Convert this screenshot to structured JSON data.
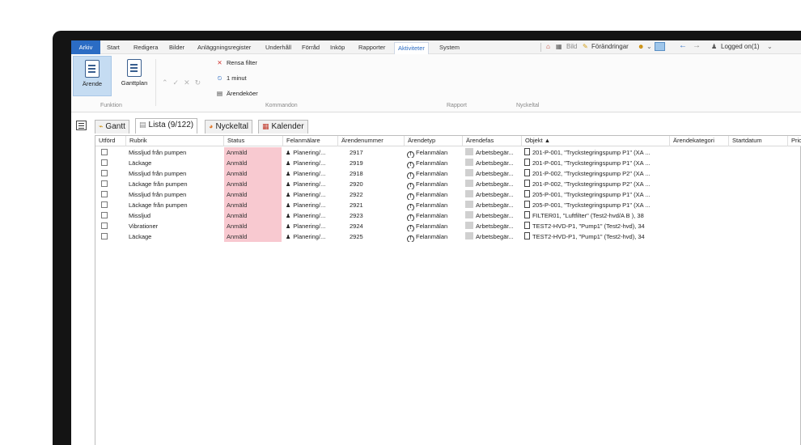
{
  "menu": {
    "items": [
      "Arkiv",
      "Start",
      "Redigera",
      "Bilder",
      "Anläggningsregister",
      "Underhåll",
      "Förråd",
      "Inköp",
      "Rapporter",
      "Aktiviteter",
      "System"
    ],
    "active": "Aktiviteter"
  },
  "quick_access": {
    "bild_label": "Bild",
    "changes_label": "Förändringar",
    "logged_on": "Logged on(1)"
  },
  "ribbon": {
    "arende_label": "Ärende",
    "ganttplan_label": "Ganttplan",
    "rensa_filter": "Rensa filter",
    "minute_label": "1 minut",
    "arendekoer": "Ärendeköer",
    "groups": [
      "Funktion",
      "Kommandon",
      "Rapport",
      "Nyckeltal"
    ]
  },
  "tabs": [
    {
      "label": "Gantt",
      "icon": "gantt-icon"
    },
    {
      "label": "Lista (9/122)",
      "icon": "list-icon"
    },
    {
      "label": "Nyckeltal",
      "icon": "pie-icon"
    },
    {
      "label": "Kalender",
      "icon": "calendar-icon"
    }
  ],
  "grid": {
    "columns": [
      "Utförd",
      "Rubrik",
      "Status",
      "Felanmälare",
      "Ärendenummer",
      "Ärendetyp",
      "Ärendefas",
      "Objekt ▲",
      "Ärendekategori",
      "Startdatum",
      "Prio"
    ],
    "rows": [
      {
        "rubrik": "Missljud från pumpen",
        "status": "Anmäld",
        "felanmalare": "Planering/...",
        "nummer": "2917",
        "typ": "Felanmälan",
        "fas": "Arbetsbegär...",
        "objekt": "201-P-001, \"Tryckstegringspump P1\" (XA ..."
      },
      {
        "rubrik": "Läckage",
        "status": "Anmäld",
        "felanmalare": "Planering/...",
        "nummer": "2919",
        "typ": "Felanmälan",
        "fas": "Arbetsbegär...",
        "objekt": "201-P-001, \"Tryckstegringspump P1\" (XA ..."
      },
      {
        "rubrik": "Missljud från pumpen",
        "status": "Anmäld",
        "felanmalare": "Planering/...",
        "nummer": "2918",
        "typ": "Felanmälan",
        "fas": "Arbetsbegär...",
        "objekt": "201-P-002, \"Tryckstegringspump P2\" (XA ..."
      },
      {
        "rubrik": "Läckage från pumpen",
        "status": "Anmäld",
        "felanmalare": "Planering/...",
        "nummer": "2920",
        "typ": "Felanmälan",
        "fas": "Arbetsbegär...",
        "objekt": "201-P-002, \"Tryckstegringspump P2\" (XA ..."
      },
      {
        "rubrik": "Missljud från pumpen",
        "status": "Anmäld",
        "felanmalare": "Planering/...",
        "nummer": "2922",
        "typ": "Felanmälan",
        "fas": "Arbetsbegär...",
        "objekt": "205-P-001, \"Tryckstegringspump P1\" (XA ..."
      },
      {
        "rubrik": "Läckage från pumpen",
        "status": "Anmäld",
        "felanmalare": "Planering/...",
        "nummer": "2921",
        "typ": "Felanmälan",
        "fas": "Arbetsbegär...",
        "objekt": "205-P-001, \"Tryckstegringspump P1\" (XA ..."
      },
      {
        "rubrik": "Missljud",
        "status": "Anmäld",
        "felanmalare": "Planering/...",
        "nummer": "2923",
        "typ": "Felanmälan",
        "fas": "Arbetsbegär...",
        "objekt": "FILTER01, \"Luftfilter\" (Test2-hvd/A B ), 38"
      },
      {
        "rubrik": "Vibrationer",
        "status": "Anmäld",
        "felanmalare": "Planering/...",
        "nummer": "2924",
        "typ": "Felanmälan",
        "fas": "Arbetsbegär...",
        "objekt": "TEST2-HVD-P1, \"Pump1\" (Test2-hvd), 34"
      },
      {
        "rubrik": "Läckage",
        "status": "Anmäld",
        "felanmalare": "Planering/...",
        "nummer": "2925",
        "typ": "Felanmälan",
        "fas": "Arbetsbegär...",
        "objekt": "TEST2-HVD-P1, \"Pump1\" (Test2-hvd), 34"
      }
    ]
  },
  "colors": {
    "accent": "#2b6cc4",
    "status_bg": "#f8c9d0",
    "selected_button": "#c5dcf2"
  }
}
